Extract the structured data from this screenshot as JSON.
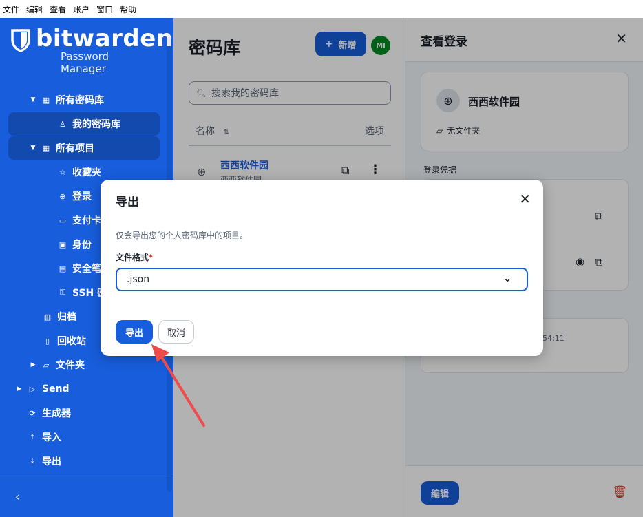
{
  "menubar": {
    "items": [
      "文件",
      "编辑",
      "查看",
      "账户",
      "窗口",
      "帮助"
    ]
  },
  "sidebar": {
    "logo_word": "bitwarden",
    "logo_sub": "Password Manager",
    "items": [
      {
        "label": "所有密码库",
        "icon": "grid-icon"
      },
      {
        "label": "我的密码库",
        "icon": "person-icon"
      },
      {
        "label": "所有项目",
        "icon": "grid-icon"
      },
      {
        "label": "收藏夹",
        "icon": "star-icon"
      },
      {
        "label": "登录",
        "icon": "globe-icon"
      },
      {
        "label": "支付卡",
        "icon": "card-icon"
      },
      {
        "label": "身份",
        "icon": "id-icon"
      },
      {
        "label": "安全笔记",
        "icon": "note-icon"
      },
      {
        "label": "SSH 密钥",
        "icon": "key-icon"
      },
      {
        "label": "归档",
        "icon": "archive-icon"
      },
      {
        "label": "回收站",
        "icon": "trash-icon"
      },
      {
        "label": "文件夹",
        "icon": "folder-icon"
      },
      {
        "label": "Send",
        "icon": "send-icon"
      },
      {
        "label": "生成器",
        "icon": "generator-icon"
      },
      {
        "label": "导入",
        "icon": "import-icon"
      },
      {
        "label": "导出",
        "icon": "export-icon"
      }
    ]
  },
  "main": {
    "title": "密码库",
    "add_label": "新增",
    "avatar": "MI",
    "search_placeholder": "搜索我的密码库",
    "col_name": "名称",
    "col_options": "选项",
    "row": {
      "name": "西西软件园",
      "sub": "西西软件园"
    }
  },
  "panel": {
    "title": "查看登录",
    "item_name": "西西软件园",
    "folder": "无文件夹",
    "section": "登录凭据",
    "time_frag": "54:11",
    "edit_label": "编辑"
  },
  "dialog": {
    "title": "导出",
    "hint": "仅会导出您的个人密码库中的项目。",
    "format_label": "文件格式",
    "required_mark": "*",
    "format_value": ".json",
    "export_label": "导出",
    "cancel_label": "取消"
  },
  "colors": {
    "brand": "#175ddc",
    "danger": "#c83522",
    "avatar": "#008b22"
  }
}
